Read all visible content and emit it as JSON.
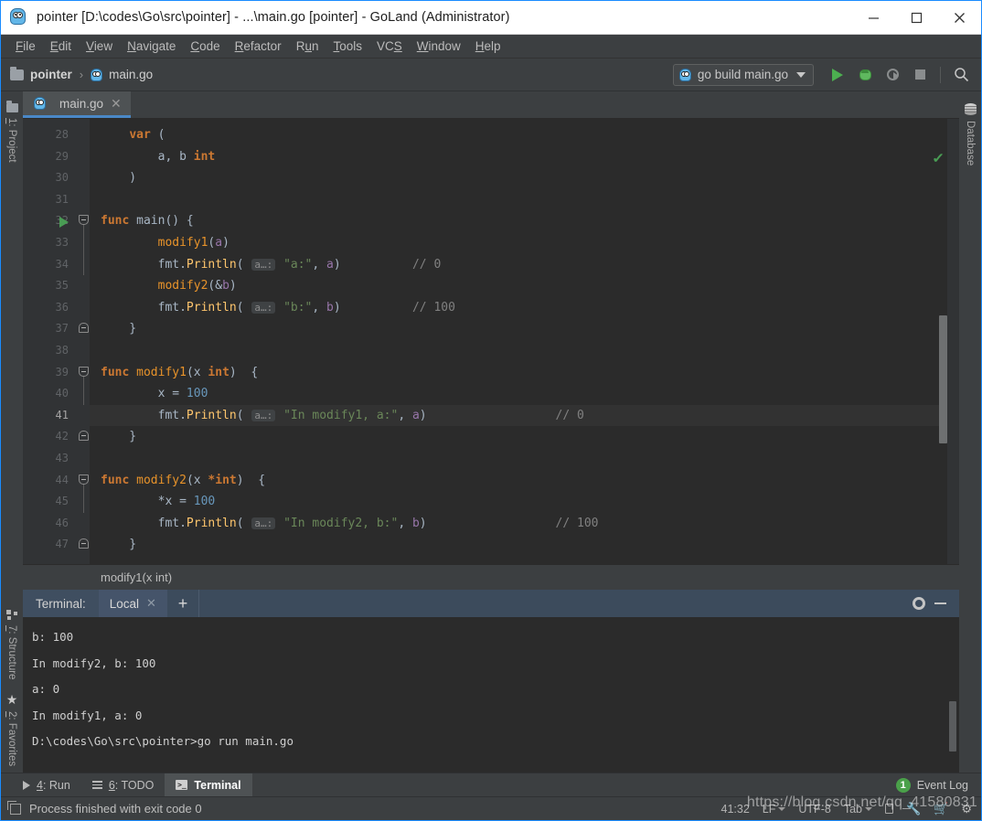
{
  "window": {
    "title": "pointer [D:\\codes\\Go\\src\\pointer] - ...\\main.go [pointer] - GoLand (Administrator)",
    "minimize_label": "—",
    "maximize_label": "□",
    "close_label": "✕"
  },
  "menubar": {
    "items": [
      {
        "label": "File",
        "mnemonic": "F",
        "rest": "ile"
      },
      {
        "label": "Edit",
        "mnemonic": "E",
        "rest": "dit"
      },
      {
        "label": "View",
        "mnemonic": "V",
        "rest": "iew"
      },
      {
        "label": "Navigate",
        "mnemonic": "N",
        "rest": "avigate"
      },
      {
        "label": "Code",
        "mnemonic": "C",
        "rest": "ode"
      },
      {
        "label": "Refactor",
        "mnemonic": "R",
        "rest": "efactor"
      },
      {
        "label": "Run",
        "mnemonic": "u",
        "pre": "R",
        "rest": "n"
      },
      {
        "label": "Tools",
        "mnemonic": "T",
        "rest": "ools"
      },
      {
        "label": "VCS",
        "mnemonic": "S",
        "pre": "VC",
        "rest": ""
      },
      {
        "label": "Window",
        "mnemonic": "W",
        "rest": "indow"
      },
      {
        "label": "Help",
        "mnemonic": "H",
        "rest": "elp"
      }
    ]
  },
  "navbar": {
    "breadcrumb_project": "pointer",
    "breadcrumb_separator": "›",
    "breadcrumb_file": "main.go",
    "run_config": "go build main.go",
    "run_tooltip": "Run",
    "debug_tooltip": "Debug",
    "coverage_tooltip": "Run with Coverage",
    "stop_tooltip": "Stop",
    "search_tooltip": "Search Everywhere"
  },
  "left_rail": {
    "project": {
      "num": "1",
      "label": ": Project"
    },
    "structure": {
      "num": "7",
      "label": ": Structure"
    },
    "favorites": {
      "num": "2",
      "label": ": Favorites"
    }
  },
  "right_rail": {
    "database": "Database"
  },
  "editor": {
    "tab_name": "main.go",
    "tab_close": "✕",
    "breadcrumb": "modify1(x int)",
    "accent_color": "#4a88c7",
    "lines": [
      {
        "n": "28",
        "tokens": [
          {
            "t": "    ",
            "c": "pln"
          },
          {
            "t": "var",
            "c": "k"
          },
          {
            "t": " (",
            "c": "pln"
          }
        ]
      },
      {
        "n": "29",
        "tokens": [
          {
            "t": "        a, b ",
            "c": "pln"
          },
          {
            "t": "int",
            "c": "k"
          }
        ]
      },
      {
        "n": "30",
        "tokens": [
          {
            "t": "    )",
            "c": "pln"
          }
        ]
      },
      {
        "n": "31",
        "tokens": []
      },
      {
        "n": "32",
        "run": true,
        "fold": "open",
        "tokens": [
          {
            "t": "func ",
            "c": "k"
          },
          {
            "t": "main",
            "c": "pln"
          },
          {
            "t": "() {",
            "c": "pln"
          }
        ]
      },
      {
        "n": "33",
        "tokens": [
          {
            "t": "        ",
            "c": "pln"
          },
          {
            "t": "modify1",
            "c": "fnorange"
          },
          {
            "t": "(",
            "c": "pln"
          },
          {
            "t": "a",
            "c": "var"
          },
          {
            "t": ")",
            "c": "pln"
          }
        ]
      },
      {
        "n": "34",
        "tokens": [
          {
            "t": "        fmt.",
            "c": "pln"
          },
          {
            "t": "Println",
            "c": "fn"
          },
          {
            "t": "( ",
            "c": "pln"
          },
          {
            "t": "a…:",
            "c": "hint"
          },
          {
            "t": " ",
            "c": "pln"
          },
          {
            "t": "\"a:\"",
            "c": "str"
          },
          {
            "t": ", ",
            "c": "pln"
          },
          {
            "t": "a",
            "c": "var"
          },
          {
            "t": ")",
            "c": "pln"
          },
          {
            "t": "          ",
            "c": "pln"
          },
          {
            "t": "// 0",
            "c": "cmt"
          }
        ]
      },
      {
        "n": "35",
        "tokens": [
          {
            "t": "        ",
            "c": "pln"
          },
          {
            "t": "modify2",
            "c": "fnorange"
          },
          {
            "t": "(&",
            "c": "pln"
          },
          {
            "t": "b",
            "c": "var"
          },
          {
            "t": ")",
            "c": "pln"
          }
        ]
      },
      {
        "n": "36",
        "tokens": [
          {
            "t": "        fmt.",
            "c": "pln"
          },
          {
            "t": "Println",
            "c": "fn"
          },
          {
            "t": "( ",
            "c": "pln"
          },
          {
            "t": "a…:",
            "c": "hint"
          },
          {
            "t": " ",
            "c": "pln"
          },
          {
            "t": "\"b:\"",
            "c": "str"
          },
          {
            "t": ", ",
            "c": "pln"
          },
          {
            "t": "b",
            "c": "var"
          },
          {
            "t": ")",
            "c": "pln"
          },
          {
            "t": "          ",
            "c": "pln"
          },
          {
            "t": "// 100",
            "c": "cmt"
          }
        ]
      },
      {
        "n": "37",
        "fold": "close",
        "tokens": [
          {
            "t": "    }",
            "c": "pln"
          }
        ]
      },
      {
        "n": "38",
        "tokens": []
      },
      {
        "n": "39",
        "fold": "open",
        "tokens": [
          {
            "t": "func ",
            "c": "k"
          },
          {
            "t": "modify1",
            "c": "fnorange"
          },
          {
            "t": "(",
            "c": "pln"
          },
          {
            "t": "x ",
            "c": "pln"
          },
          {
            "t": "int",
            "c": "k"
          },
          {
            "t": ")  {",
            "c": "pln"
          }
        ]
      },
      {
        "n": "40",
        "tokens": [
          {
            "t": "        x = ",
            "c": "pln"
          },
          {
            "t": "100",
            "c": "num"
          }
        ]
      },
      {
        "n": "41",
        "cur": true,
        "hl": true,
        "tokens": [
          {
            "t": "        fmt.",
            "c": "pln"
          },
          {
            "t": "Println",
            "c": "fn"
          },
          {
            "t": "( ",
            "c": "pln"
          },
          {
            "t": "a…:",
            "c": "hint"
          },
          {
            "t": " ",
            "c": "pln"
          },
          {
            "t": "\"In modify1, a:\"",
            "c": "str"
          },
          {
            "t": ", ",
            "c": "pln"
          },
          {
            "t": "a",
            "c": "var"
          },
          {
            "t": ")",
            "c": "pln"
          },
          {
            "t": "                  ",
            "c": "pln"
          },
          {
            "t": "// 0",
            "c": "cmt"
          }
        ]
      },
      {
        "n": "42",
        "fold": "close",
        "tokens": [
          {
            "t": "    }",
            "c": "pln"
          }
        ]
      },
      {
        "n": "43",
        "tokens": []
      },
      {
        "n": "44",
        "fold": "open",
        "tokens": [
          {
            "t": "func ",
            "c": "k"
          },
          {
            "t": "modify2",
            "c": "fnorange"
          },
          {
            "t": "(",
            "c": "pln"
          },
          {
            "t": "x ",
            "c": "pln"
          },
          {
            "t": "*int",
            "c": "k"
          },
          {
            "t": ")  {",
            "c": "pln"
          }
        ]
      },
      {
        "n": "45",
        "tokens": [
          {
            "t": "        *x = ",
            "c": "pln"
          },
          {
            "t": "100",
            "c": "num"
          }
        ]
      },
      {
        "n": "46",
        "tokens": [
          {
            "t": "        fmt.",
            "c": "pln"
          },
          {
            "t": "Println",
            "c": "fn"
          },
          {
            "t": "( ",
            "c": "pln"
          },
          {
            "t": "a…:",
            "c": "hint"
          },
          {
            "t": " ",
            "c": "pln"
          },
          {
            "t": "\"In modify2, b:\"",
            "c": "str"
          },
          {
            "t": ", ",
            "c": "pln"
          },
          {
            "t": "b",
            "c": "var"
          },
          {
            "t": ")",
            "c": "pln"
          },
          {
            "t": "                  ",
            "c": "pln"
          },
          {
            "t": "// 100",
            "c": "cmt"
          }
        ]
      },
      {
        "n": "47",
        "fold": "close",
        "tokens": [
          {
            "t": "    }",
            "c": "pln"
          }
        ]
      }
    ]
  },
  "terminal": {
    "label": "Terminal:",
    "tab_name": "Local",
    "tab_close": "✕",
    "add_label": "+",
    "settings_tooltip": "Settings",
    "hide_tooltip": "Hide",
    "output": [
      "D:\\codes\\Go\\src\\pointer>go run main.go",
      "In modify1, a: 0",
      "a: 0",
      "In modify2, b: 100",
      "b: 100"
    ]
  },
  "tool_tabs": {
    "run": {
      "num": "4",
      "label": ": Run"
    },
    "todo": {
      "num": "6",
      "label": ": TODO"
    },
    "terminal": "Terminal",
    "event_log": "Event Log",
    "event_count": "1",
    "event_badge_color": "#4aa14a"
  },
  "statusbar": {
    "message": "Process finished with exit code 0",
    "caret": "41:32",
    "line_sep": "LF",
    "encoding": "UTF-8",
    "indent": "Tab",
    "watermark": "https://blog.csdn.net/qq_41580831"
  }
}
